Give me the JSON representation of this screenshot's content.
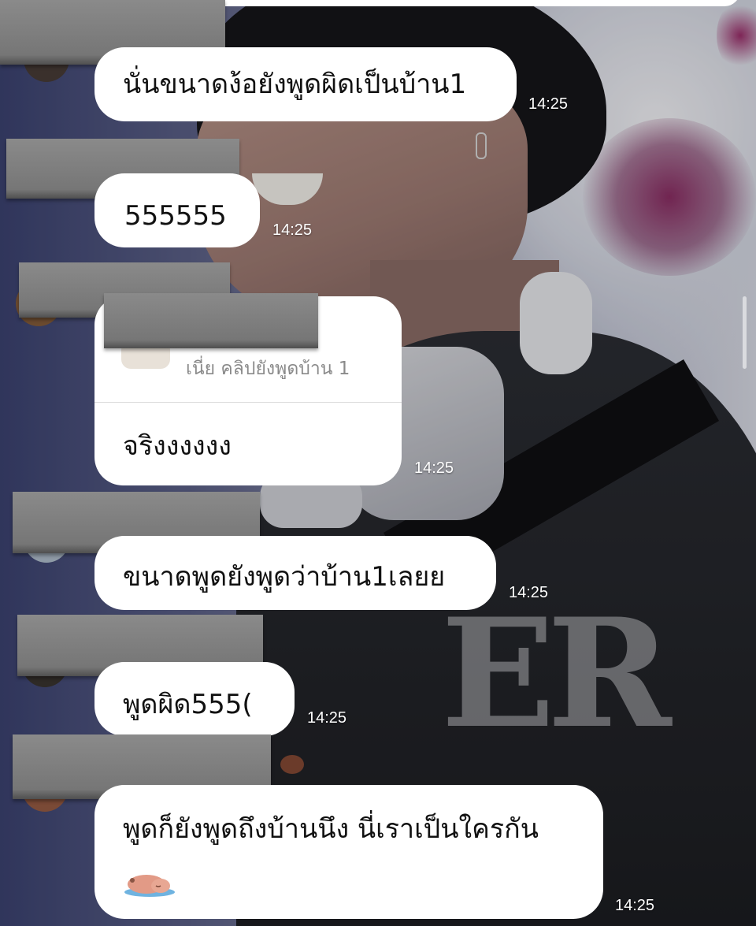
{
  "messages": [
    {
      "text": "นั่นขนาดง้อยังพูดผิดเป็นบ้าน1",
      "time": "14:25"
    },
    {
      "text": "555555",
      "time": "14:25"
    },
    {
      "reply_to": "เนี่ย คลิปยังพูดบ้าน 1",
      "text": "จริงงงงงง",
      "time": "14:25"
    },
    {
      "text": "ขนาดพูดยังพูดว่าบ้าน1เลยย",
      "time": "14:25"
    },
    {
      "text": "พูดผิด555(",
      "time": "14:25"
    },
    {
      "text": "พูดก็ยังพูดถึงบ้านนึง นี่เราเป็นใครกัน",
      "sticker": "sleeping-capybara-sticker",
      "time": "14:25"
    }
  ],
  "background": {
    "photo": "person-with-headphones-photo",
    "hoodie_text": "ER"
  },
  "colors": {
    "bubble": "#ffffff",
    "time": "#ffffff",
    "redaction": "#7d7d7d"
  }
}
